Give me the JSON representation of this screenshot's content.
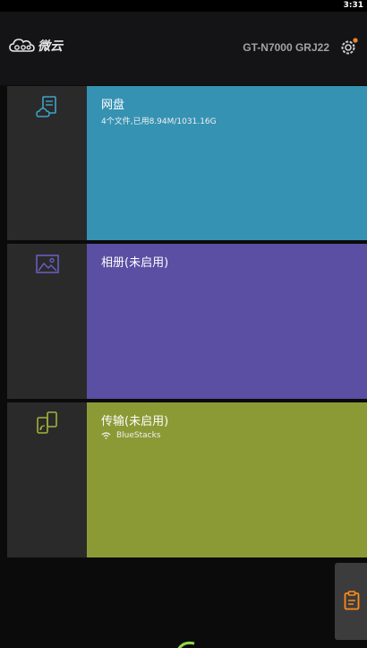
{
  "status_bar": {
    "time": "3:31"
  },
  "header": {
    "logo_text": "微云",
    "device_name": "GT-N7000 GRJ22",
    "settings_icon": "gear-icon",
    "notification_dot_color": "#f0842c"
  },
  "tiles": [
    {
      "icon": "cloud-document-icon",
      "title": "网盘",
      "subtitle": "4个文件,已用8.94M/1031.16G",
      "color": "#3592b3",
      "icon_color": "#3fa4c8"
    },
    {
      "icon": "image-icon",
      "title": "相册(未启用)",
      "subtitle": "",
      "color": "#5a4fa3",
      "icon_color": "#6a5cc0"
    },
    {
      "icon": "devices-icon",
      "title": "传输(未启用)",
      "subtitle": "BlueStacks",
      "subtitle_icon": "wifi-icon",
      "color": "#8c9a36",
      "icon_color": "#a3b13a"
    }
  ],
  "floating": {
    "clipboard_icon": "clipboard-icon",
    "icon_color": "#ff8a1a"
  }
}
